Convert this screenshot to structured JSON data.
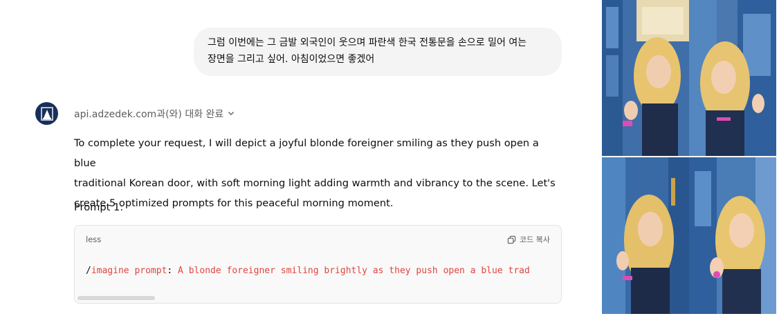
{
  "user_message": {
    "line1": "그럼 이번에는 그 금발 외국인이 웃으며 파란색 한국 전통문을 손으로 밀어 여는",
    "line2": "장면을 그리고 싶어. 아침이었으면 좋겠어"
  },
  "assistant": {
    "tool_status": "api.adzedek.com과(와) 대화 완료",
    "tool_status_icon": "chevron-down-icon",
    "response_line1": "To complete your request, I will depict a joyful blonde foreigner smiling as they push open a blue",
    "response_line2": "traditional Korean door, with soft morning light adding warmth and vibrancy to the scene. Let's",
    "response_line3": "create 5 optimized prompts for this peaceful morning moment.",
    "prompt_label": "Prompt 1:"
  },
  "code_block": {
    "language": "less",
    "copy_label": "코드 복사",
    "code_prefix": "/",
    "code_command": "imagine prompt",
    "code_colon": ":",
    "code_text": " A blonde foreigner smiling brightly as they push open a blue trad"
  },
  "colors": {
    "accent_red": "#e0453e",
    "bubble_bg": "#f4f4f4",
    "avatar_bg": "#17305a",
    "door_blue": "#2f5f9c"
  }
}
